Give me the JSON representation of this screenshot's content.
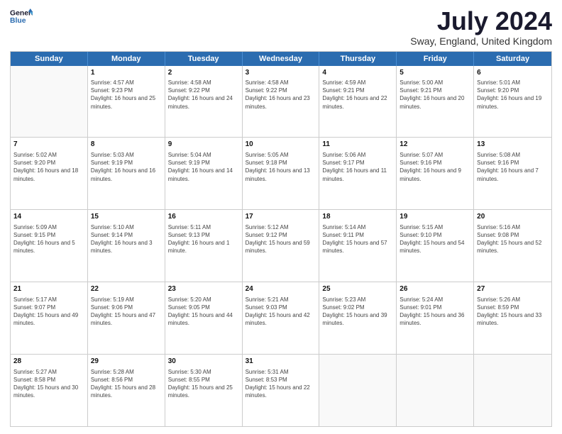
{
  "header": {
    "logo_line1": "General",
    "logo_line2": "Blue",
    "month_year": "July 2024",
    "location": "Sway, England, United Kingdom"
  },
  "weekdays": [
    "Sunday",
    "Monday",
    "Tuesday",
    "Wednesday",
    "Thursday",
    "Friday",
    "Saturday"
  ],
  "rows": [
    [
      {
        "day": "",
        "sunrise": "",
        "sunset": "",
        "daylight": ""
      },
      {
        "day": "1",
        "sunrise": "Sunrise: 4:57 AM",
        "sunset": "Sunset: 9:23 PM",
        "daylight": "Daylight: 16 hours and 25 minutes."
      },
      {
        "day": "2",
        "sunrise": "Sunrise: 4:58 AM",
        "sunset": "Sunset: 9:22 PM",
        "daylight": "Daylight: 16 hours and 24 minutes."
      },
      {
        "day": "3",
        "sunrise": "Sunrise: 4:58 AM",
        "sunset": "Sunset: 9:22 PM",
        "daylight": "Daylight: 16 hours and 23 minutes."
      },
      {
        "day": "4",
        "sunrise": "Sunrise: 4:59 AM",
        "sunset": "Sunset: 9:21 PM",
        "daylight": "Daylight: 16 hours and 22 minutes."
      },
      {
        "day": "5",
        "sunrise": "Sunrise: 5:00 AM",
        "sunset": "Sunset: 9:21 PM",
        "daylight": "Daylight: 16 hours and 20 minutes."
      },
      {
        "day": "6",
        "sunrise": "Sunrise: 5:01 AM",
        "sunset": "Sunset: 9:20 PM",
        "daylight": "Daylight: 16 hours and 19 minutes."
      }
    ],
    [
      {
        "day": "7",
        "sunrise": "Sunrise: 5:02 AM",
        "sunset": "Sunset: 9:20 PM",
        "daylight": "Daylight: 16 hours and 18 minutes."
      },
      {
        "day": "8",
        "sunrise": "Sunrise: 5:03 AM",
        "sunset": "Sunset: 9:19 PM",
        "daylight": "Daylight: 16 hours and 16 minutes."
      },
      {
        "day": "9",
        "sunrise": "Sunrise: 5:04 AM",
        "sunset": "Sunset: 9:19 PM",
        "daylight": "Daylight: 16 hours and 14 minutes."
      },
      {
        "day": "10",
        "sunrise": "Sunrise: 5:05 AM",
        "sunset": "Sunset: 9:18 PM",
        "daylight": "Daylight: 16 hours and 13 minutes."
      },
      {
        "day": "11",
        "sunrise": "Sunrise: 5:06 AM",
        "sunset": "Sunset: 9:17 PM",
        "daylight": "Daylight: 16 hours and 11 minutes."
      },
      {
        "day": "12",
        "sunrise": "Sunrise: 5:07 AM",
        "sunset": "Sunset: 9:16 PM",
        "daylight": "Daylight: 16 hours and 9 minutes."
      },
      {
        "day": "13",
        "sunrise": "Sunrise: 5:08 AM",
        "sunset": "Sunset: 9:16 PM",
        "daylight": "Daylight: 16 hours and 7 minutes."
      }
    ],
    [
      {
        "day": "14",
        "sunrise": "Sunrise: 5:09 AM",
        "sunset": "Sunset: 9:15 PM",
        "daylight": "Daylight: 16 hours and 5 minutes."
      },
      {
        "day": "15",
        "sunrise": "Sunrise: 5:10 AM",
        "sunset": "Sunset: 9:14 PM",
        "daylight": "Daylight: 16 hours and 3 minutes."
      },
      {
        "day": "16",
        "sunrise": "Sunrise: 5:11 AM",
        "sunset": "Sunset: 9:13 PM",
        "daylight": "Daylight: 16 hours and 1 minute."
      },
      {
        "day": "17",
        "sunrise": "Sunrise: 5:12 AM",
        "sunset": "Sunset: 9:12 PM",
        "daylight": "Daylight: 15 hours and 59 minutes."
      },
      {
        "day": "18",
        "sunrise": "Sunrise: 5:14 AM",
        "sunset": "Sunset: 9:11 PM",
        "daylight": "Daylight: 15 hours and 57 minutes."
      },
      {
        "day": "19",
        "sunrise": "Sunrise: 5:15 AM",
        "sunset": "Sunset: 9:10 PM",
        "daylight": "Daylight: 15 hours and 54 minutes."
      },
      {
        "day": "20",
        "sunrise": "Sunrise: 5:16 AM",
        "sunset": "Sunset: 9:08 PM",
        "daylight": "Daylight: 15 hours and 52 minutes."
      }
    ],
    [
      {
        "day": "21",
        "sunrise": "Sunrise: 5:17 AM",
        "sunset": "Sunset: 9:07 PM",
        "daylight": "Daylight: 15 hours and 49 minutes."
      },
      {
        "day": "22",
        "sunrise": "Sunrise: 5:19 AM",
        "sunset": "Sunset: 9:06 PM",
        "daylight": "Daylight: 15 hours and 47 minutes."
      },
      {
        "day": "23",
        "sunrise": "Sunrise: 5:20 AM",
        "sunset": "Sunset: 9:05 PM",
        "daylight": "Daylight: 15 hours and 44 minutes."
      },
      {
        "day": "24",
        "sunrise": "Sunrise: 5:21 AM",
        "sunset": "Sunset: 9:03 PM",
        "daylight": "Daylight: 15 hours and 42 minutes."
      },
      {
        "day": "25",
        "sunrise": "Sunrise: 5:23 AM",
        "sunset": "Sunset: 9:02 PM",
        "daylight": "Daylight: 15 hours and 39 minutes."
      },
      {
        "day": "26",
        "sunrise": "Sunrise: 5:24 AM",
        "sunset": "Sunset: 9:01 PM",
        "daylight": "Daylight: 15 hours and 36 minutes."
      },
      {
        "day": "27",
        "sunrise": "Sunrise: 5:26 AM",
        "sunset": "Sunset: 8:59 PM",
        "daylight": "Daylight: 15 hours and 33 minutes."
      }
    ],
    [
      {
        "day": "28",
        "sunrise": "Sunrise: 5:27 AM",
        "sunset": "Sunset: 8:58 PM",
        "daylight": "Daylight: 15 hours and 30 minutes."
      },
      {
        "day": "29",
        "sunrise": "Sunrise: 5:28 AM",
        "sunset": "Sunset: 8:56 PM",
        "daylight": "Daylight: 15 hours and 28 minutes."
      },
      {
        "day": "30",
        "sunrise": "Sunrise: 5:30 AM",
        "sunset": "Sunset: 8:55 PM",
        "daylight": "Daylight: 15 hours and 25 minutes."
      },
      {
        "day": "31",
        "sunrise": "Sunrise: 5:31 AM",
        "sunset": "Sunset: 8:53 PM",
        "daylight": "Daylight: 15 hours and 22 minutes."
      },
      {
        "day": "",
        "sunrise": "",
        "sunset": "",
        "daylight": ""
      },
      {
        "day": "",
        "sunrise": "",
        "sunset": "",
        "daylight": ""
      },
      {
        "day": "",
        "sunrise": "",
        "sunset": "",
        "daylight": ""
      }
    ]
  ]
}
